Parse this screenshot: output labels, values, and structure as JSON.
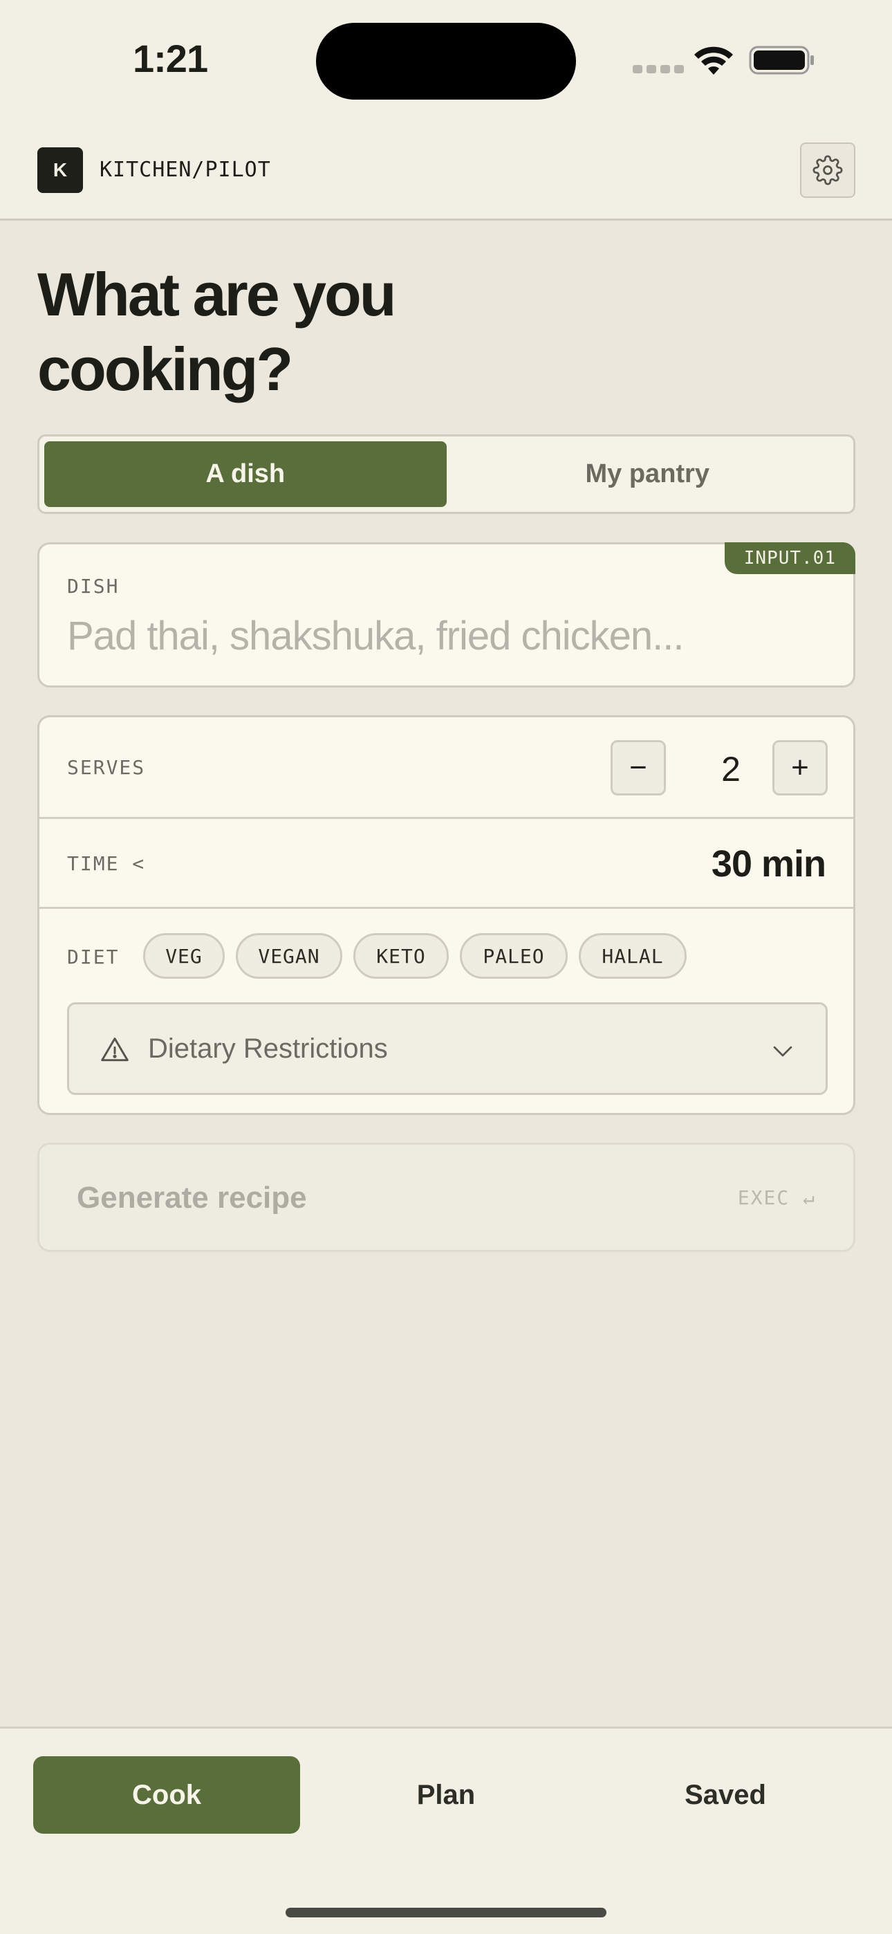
{
  "status_bar": {
    "time": "1:21"
  },
  "header": {
    "logo_letter": "K",
    "app_name": "KITCHEN/PILOT",
    "settings_icon": "gear-icon"
  },
  "headline": "What are you cooking?",
  "mode_toggle": {
    "options": [
      "A dish",
      "My pantry"
    ],
    "selected": "A dish"
  },
  "dish": {
    "tag": "INPUT.01",
    "label": "DISH",
    "value": "",
    "placeholder": "Pad thai, shakshuka, fried chicken..."
  },
  "serves": {
    "label": "SERVES",
    "decrement": "−",
    "value": "2",
    "increment": "+"
  },
  "time": {
    "label": "TIME <",
    "value": "30 min"
  },
  "diet": {
    "label": "DIET",
    "chips": [
      "VEG",
      "VEGAN",
      "KETO",
      "PALEO",
      "HALAL"
    ],
    "restrictions_label": "Dietary Restrictions",
    "restrictions_icon": "warning-icon",
    "dropdown_icon": "chevron-down-icon"
  },
  "generate": {
    "label": "Generate recipe",
    "hint": "EXEC ↵",
    "enabled": false
  },
  "tabbar": {
    "tabs": [
      "Cook",
      "Plan",
      "Saved"
    ],
    "active": "Cook"
  },
  "colors": {
    "accent": "#5a6e3c",
    "background": "#ebe7dc",
    "card": "#fbf9ee",
    "text": "#1d1e18"
  }
}
